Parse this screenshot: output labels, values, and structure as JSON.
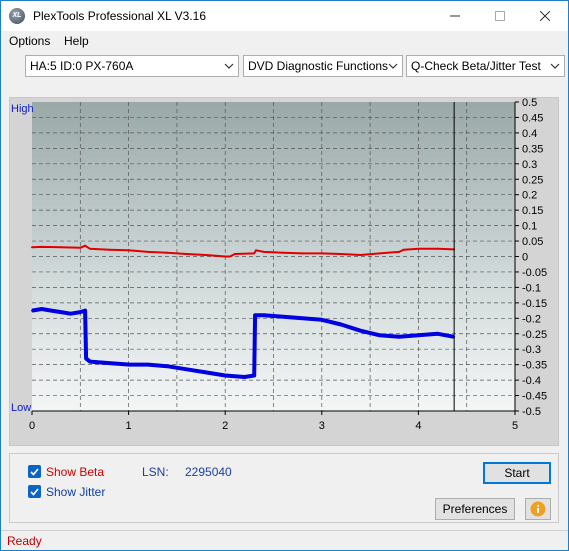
{
  "window": {
    "title": "PlexTools Professional XL V3.16",
    "icon_text": "XL"
  },
  "menu": {
    "items": [
      "Options",
      "Help"
    ]
  },
  "toolbar": {
    "drive": "HA:5 ID:0  PX-760A",
    "function_group": "DVD Diagnostic Functions",
    "test": "Q-Check Beta/Jitter Test"
  },
  "chart_data": {
    "type": "line",
    "left_axis_labels": {
      "top": "High",
      "bottom": "Low"
    },
    "x_ticks": [
      "0",
      "1",
      "2",
      "3",
      "4",
      "5"
    ],
    "xlim": [
      0,
      5
    ],
    "ylim": [
      -0.5,
      0.5
    ],
    "y_ticks": [
      "0.5",
      "0.45",
      "0.4",
      "0.35",
      "0.3",
      "0.25",
      "0.2",
      "0.15",
      "0.1",
      "0.05",
      "0",
      "-0.05",
      "-0.1",
      "-0.15",
      "-0.2",
      "-0.25",
      "-0.3",
      "-0.35",
      "-0.4",
      "-0.45",
      "-0.5"
    ],
    "grid": true,
    "end_marker_x": 4.37,
    "series": [
      {
        "color": "#e00000",
        "x": [
          0,
          0.1,
          0.3,
          0.5,
          0.55,
          0.6,
          0.8,
          1.0,
          1.2,
          1.4,
          1.6,
          1.8,
          2.0,
          2.05,
          2.1,
          2.3,
          2.32,
          2.4,
          2.6,
          2.8,
          3.0,
          3.2,
          3.4,
          3.6,
          3.8,
          3.85,
          4.0,
          4.2,
          4.37
        ],
        "values": [
          0.03,
          0.031,
          0.03,
          0.028,
          0.035,
          0.025,
          0.022,
          0.02,
          0.015,
          0.012,
          0.008,
          0.005,
          0.0,
          0.0,
          0.008,
          0.01,
          0.02,
          0.015,
          0.012,
          0.01,
          0.01,
          0.008,
          0.005,
          0.01,
          0.015,
          0.022,
          0.025,
          0.025,
          0.023
        ]
      },
      {
        "color": "#0000e0",
        "x": [
          0,
          0.1,
          0.2,
          0.3,
          0.4,
          0.5,
          0.55,
          0.56,
          0.6,
          0.8,
          1.0,
          1.2,
          1.4,
          1.6,
          1.8,
          2.0,
          2.2,
          2.3,
          2.31,
          2.4,
          2.6,
          2.8,
          3.0,
          3.2,
          3.4,
          3.6,
          3.8,
          4.0,
          4.2,
          4.37
        ],
        "values": [
          -0.175,
          -0.17,
          -0.175,
          -0.18,
          -0.185,
          -0.18,
          -0.175,
          -0.33,
          -0.34,
          -0.345,
          -0.35,
          -0.35,
          -0.355,
          -0.365,
          -0.375,
          -0.385,
          -0.39,
          -0.385,
          -0.19,
          -0.19,
          -0.195,
          -0.2,
          -0.205,
          -0.22,
          -0.24,
          -0.255,
          -0.26,
          -0.255,
          -0.25,
          -0.26
        ]
      }
    ]
  },
  "controls": {
    "show_beta": "Show Beta",
    "show_jitter": "Show Jitter",
    "lsn_label": "LSN:",
    "lsn_value": "2295040",
    "start": "Start",
    "preferences": "Preferences"
  },
  "colors": {
    "beta_label": "#d00000",
    "jitter_label": "#1040a0",
    "lsn": "#1c3f9f",
    "status": "#c00000"
  },
  "status": {
    "text": "Ready"
  }
}
